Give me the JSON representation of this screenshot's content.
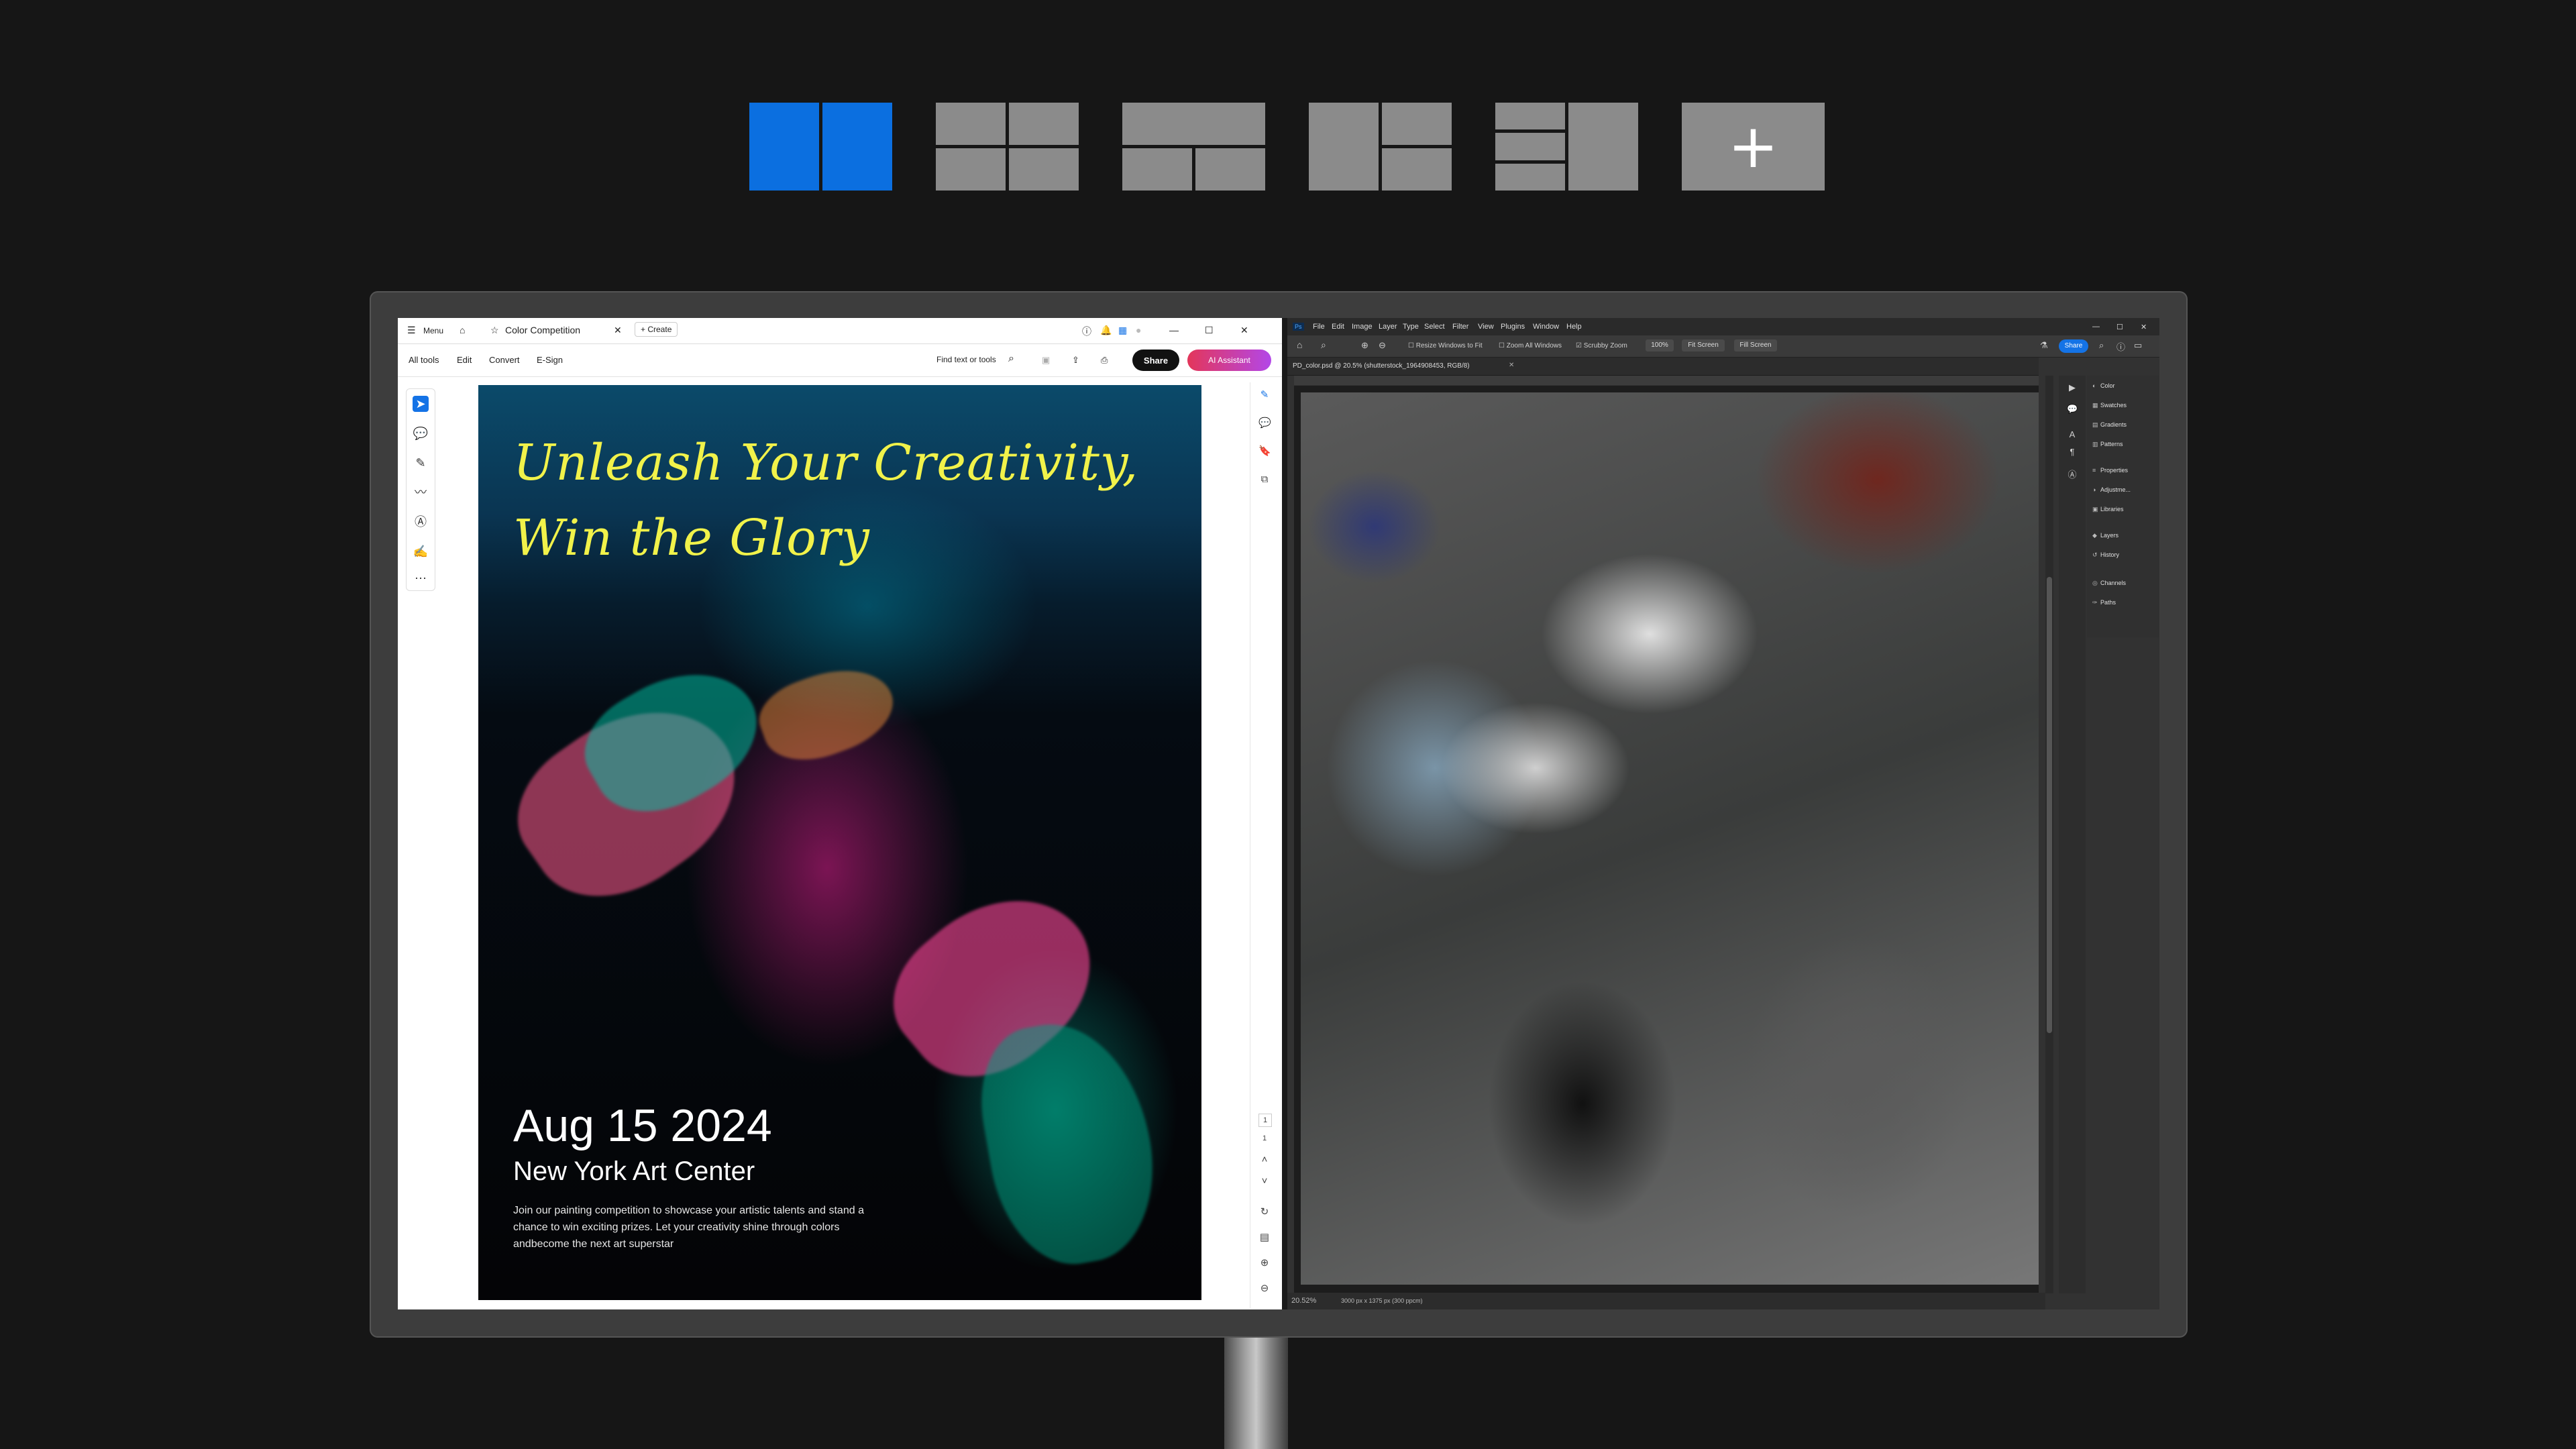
{
  "layout_picker": {
    "options": [
      {
        "name": "two-column",
        "selected": true
      },
      {
        "name": "one-left-two-right",
        "selected": false
      },
      {
        "name": "one-top-two-bottom",
        "selected": false
      },
      {
        "name": "one-left-two-right-alt",
        "selected": false
      },
      {
        "name": "three-left-one-right",
        "selected": false
      },
      {
        "name": "add-custom",
        "selected": false
      }
    ],
    "add_symbol": "+",
    "accent": "#0b6fe0"
  },
  "acrobat": {
    "tabbar": {
      "menu": "Menu",
      "tab_title": "Color Competition",
      "create": "Create"
    },
    "menubar": {
      "all_tools": "All tools",
      "edit": "Edit",
      "convert": "Convert",
      "esign": "E-Sign",
      "find_placeholder": "Find text or tools",
      "share": "Share",
      "ai_assistant": "AI Assistant"
    },
    "poster": {
      "title_line1": "Unleash Your Creativity,",
      "title_line2": "Win the Glory",
      "date": "Aug 15 2024",
      "venue": "New York Art Center",
      "description": "Join our painting competition to showcase your artistic talents and stand a chance to win exciting prizes. Let your creativity shine through colors andbecome the next art superstar"
    },
    "page_indicator": {
      "current": "1",
      "total": "1"
    }
  },
  "photoshop": {
    "app_badge": "Ps",
    "menu": [
      "File",
      "Edit",
      "Image",
      "Layer",
      "Type",
      "Select",
      "Filter",
      "View",
      "Plugins",
      "Window",
      "Help"
    ],
    "options": {
      "resize": "Resize Windows to Fit",
      "zoom_all": "Zoom All Windows",
      "scrubby": "Scrubby Zoom",
      "zoom_value": "100%",
      "fit_screen": "Fit Screen",
      "fill_screen": "Fill Screen"
    },
    "share": "Share",
    "document_tab": "PD_color.psd @ 20.5% (shutterstock_1964908453, RGB/8)",
    "status": {
      "zoom": "20.52%",
      "dims": "3000 px x 1375 px (300 ppcm)"
    },
    "panels": [
      "Color",
      "Swatches",
      "Gradients",
      "Patterns",
      "Properties",
      "Adjustme...",
      "Libraries",
      "Layers",
      "History",
      "Channels",
      "Paths"
    ]
  }
}
